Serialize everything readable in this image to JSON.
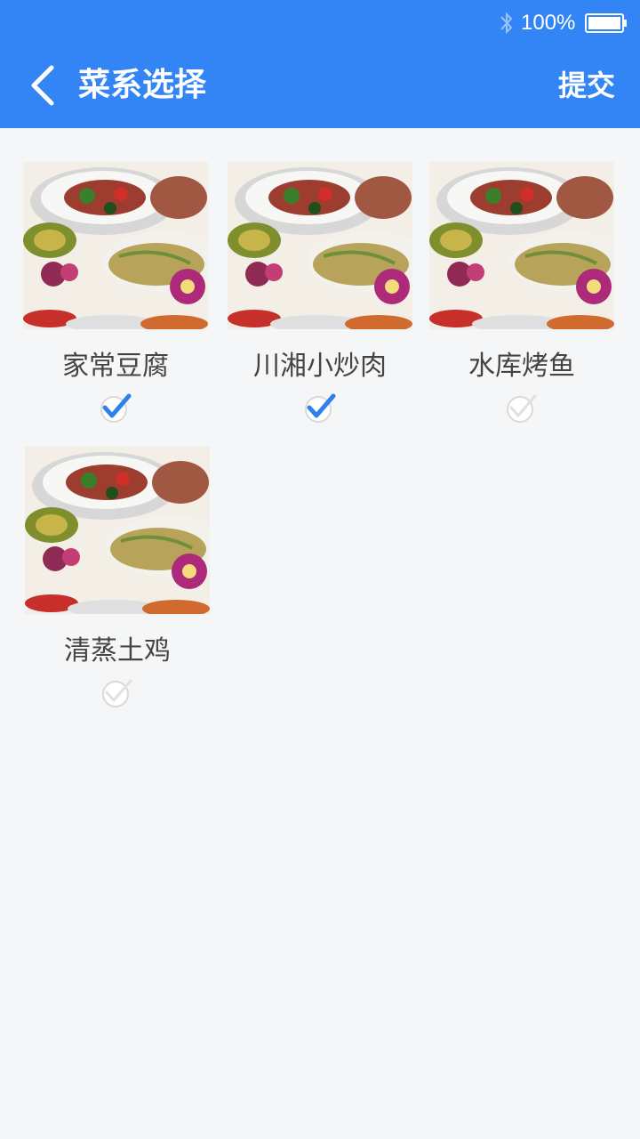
{
  "status_bar": {
    "battery_text": "100%",
    "icons": [
      "bluetooth-icon",
      "battery-icon"
    ]
  },
  "nav": {
    "back_icon": "chevron-left-icon",
    "title": "菜系选择",
    "submit_label": "提交"
  },
  "dishes": [
    {
      "name": "家常豆腐",
      "checked": true
    },
    {
      "name": "川湘小炒肉",
      "checked": true
    },
    {
      "name": "水库烤鱼",
      "checked": false
    },
    {
      "name": "清蒸土鸡",
      "checked": false
    }
  ],
  "colors": {
    "accent": "#3385f6",
    "background": "#f5f6f8",
    "text": "#444444",
    "check_on": "#2f80ed",
    "check_off": "#d9d9d9"
  }
}
